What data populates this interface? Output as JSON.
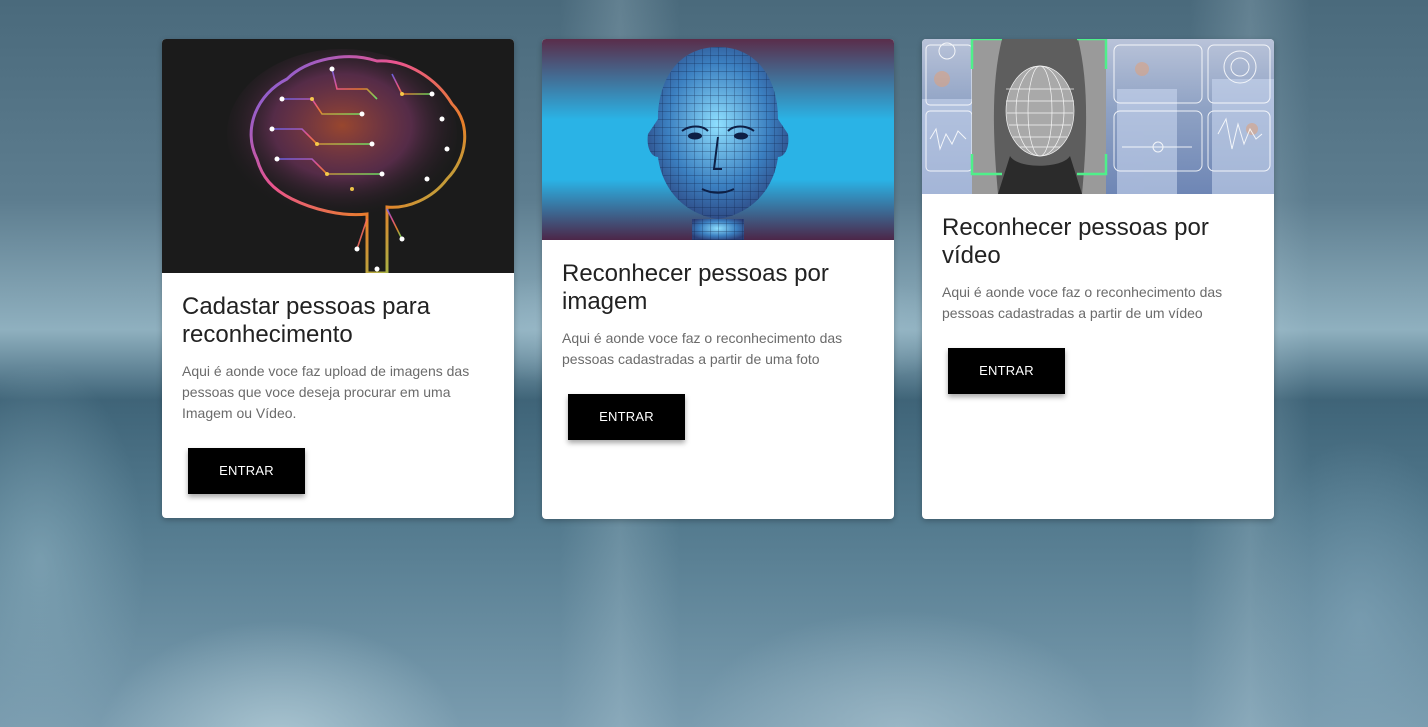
{
  "cards": [
    {
      "title": "Cadastar pessoas para reconhecimento",
      "text": "Aqui é aonde voce faz upload de imagens das pessoas que voce deseja procurar em uma Imagem ou Vídeo.",
      "button": "ENTRAR",
      "image": "circuit-brain-image"
    },
    {
      "title": "Reconhecer pessoas por imagem",
      "text": "Aqui é aonde voce faz o reconhecimento das pessoas cadastradas a partir de uma foto",
      "button": "ENTRAR",
      "image": "wireframe-face-image"
    },
    {
      "title": "Reconhecer pessoas por vídeo",
      "text": "Aqui é aonde voce faz o reconhecimento das pessoas cadastradas a partir de um vídeo",
      "button": "ENTRAR",
      "image": "face-scan-hud-image"
    }
  ],
  "colors": {
    "button_bg": "#000000",
    "button_text": "#ffffff",
    "card_bg": "#ffffff",
    "title_text": "#222222",
    "body_text": "#6b6b6b"
  }
}
